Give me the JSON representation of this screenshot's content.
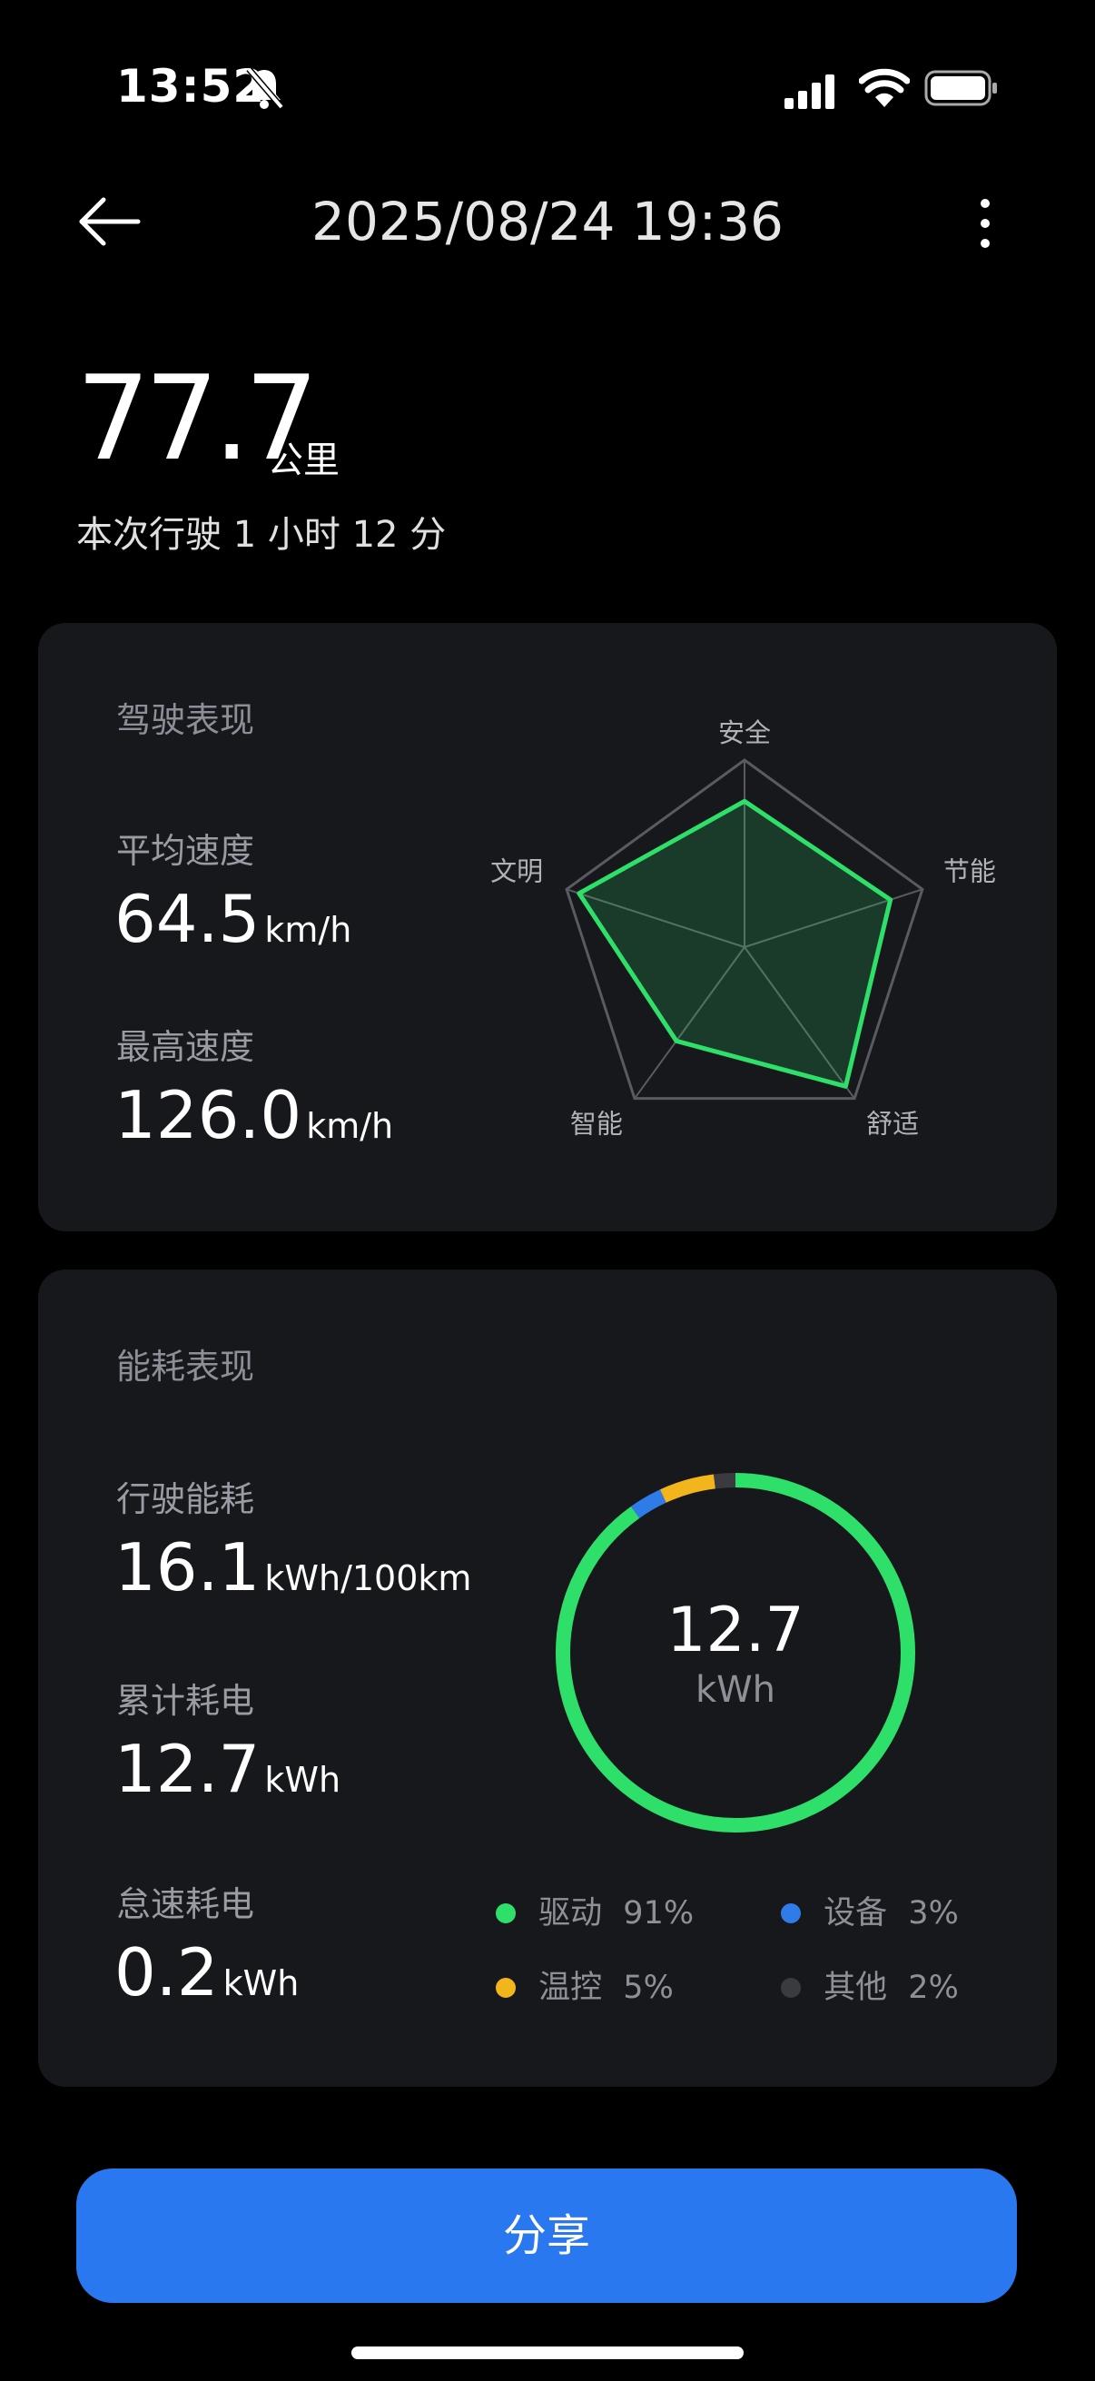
{
  "status_bar": {
    "time": "13:52"
  },
  "header": {
    "title": "2025/08/24 19:36"
  },
  "trip": {
    "distance": "77.7",
    "distance_unit": "公里",
    "duration": "本次行驶 1 小时 12 分"
  },
  "driving": {
    "title": "驾驶表现",
    "avg_speed_label": "平均速度",
    "avg_speed_value": "64.5",
    "avg_speed_unit": "km/h",
    "max_speed_label": "最高速度",
    "max_speed_value": "126.0",
    "max_speed_unit": "km/h",
    "radar": {
      "axes": [
        "安全",
        "节能",
        "舒适",
        "智能",
        "文明"
      ],
      "scores": [
        0.78,
        0.82,
        0.92,
        0.62,
        0.93
      ],
      "color": "#2ee06a"
    }
  },
  "energy": {
    "title": "能耗表现",
    "driving_consumption_label": "行驶能耗",
    "driving_consumption_value": "16.1",
    "driving_consumption_unit": "kWh/100km",
    "total_label": "累计耗电",
    "total_value": "12.7",
    "total_unit": "kWh",
    "idle_label": "怠速耗电",
    "idle_value": "0.2",
    "idle_unit": "kWh",
    "ring_center_value": "12.7",
    "ring_center_unit": "kWh",
    "breakdown": [
      {
        "name": "驱动",
        "percent": "91%",
        "value": 91,
        "color": "#2ee06a"
      },
      {
        "name": "设备",
        "percent": "3%",
        "value": 3,
        "color": "#2f7be8"
      },
      {
        "name": "温控",
        "percent": "5%",
        "value": 5,
        "color": "#f2b51c"
      },
      {
        "name": "其他",
        "percent": "2%",
        "value": 2,
        "color": "#3a3b40"
      }
    ]
  },
  "share_button": "分享"
}
